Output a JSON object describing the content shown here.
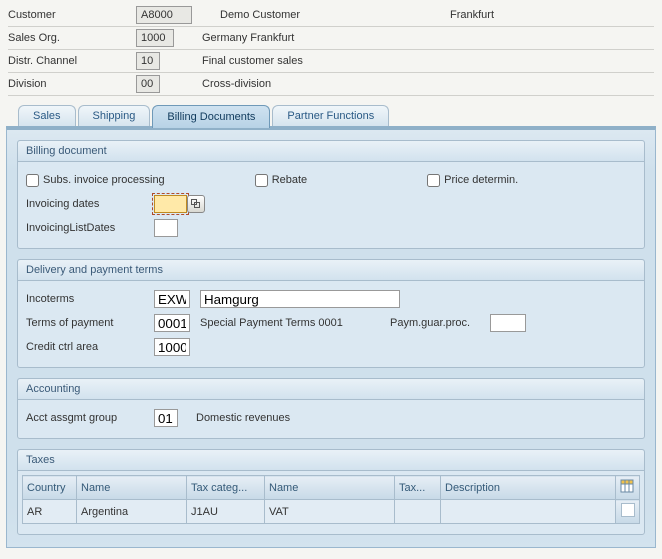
{
  "header": {
    "labels": {
      "customer": "Customer",
      "sales_org": "Sales Org.",
      "distr_channel": "Distr. Channel",
      "division": "Division"
    },
    "values": {
      "customer": "A8000",
      "sales_org": "1000",
      "distr_channel": "10",
      "division": "00"
    },
    "texts": {
      "customer_name": "Demo Customer",
      "customer_city": "Frankfurt",
      "sales_org_text": "Germany Frankfurt",
      "distr_channel_text": "Final customer sales",
      "division_text": "Cross-division"
    }
  },
  "tabs": {
    "sales": "Sales",
    "shipping": "Shipping",
    "billing": "Billing Documents",
    "partner": "Partner Functions"
  },
  "billing_doc": {
    "title": "Billing document",
    "subs_invoice_label": "Subs. invoice processing",
    "rebate_label": "Rebate",
    "price_determ_label": "Price determin.",
    "invoicing_dates_label": "Invoicing dates",
    "invoicing_dates_value": "",
    "invoicing_list_dates_label": "InvoicingListDates",
    "invoicing_list_dates_value": ""
  },
  "delivery": {
    "title": "Delivery and payment terms",
    "incoterms_label": "Incoterms",
    "incoterms_code": "EXW",
    "incoterms_text": "Hamgurg",
    "terms_label": "Terms of payment",
    "terms_code": "0001",
    "terms_text": "Special Payment Terms 0001",
    "payguar_label": "Paym.guar.proc.",
    "payguar_value": "",
    "credit_label": "Credit ctrl area",
    "credit_value": "1000"
  },
  "accounting": {
    "title": "Accounting",
    "aag_label": "Acct assgmt group",
    "aag_code": "01",
    "aag_text": "Domestic revenues"
  },
  "taxes": {
    "title": "Taxes",
    "cols": {
      "country": "Country",
      "name": "Name",
      "taxcat": "Tax categ...",
      "name2": "Name",
      "tax": "Tax...",
      "desc": "Description"
    },
    "row": {
      "country": "AR",
      "name": "Argentina",
      "taxcat": "J1AU",
      "name2": "VAT",
      "tax": "",
      "desc": ""
    }
  }
}
